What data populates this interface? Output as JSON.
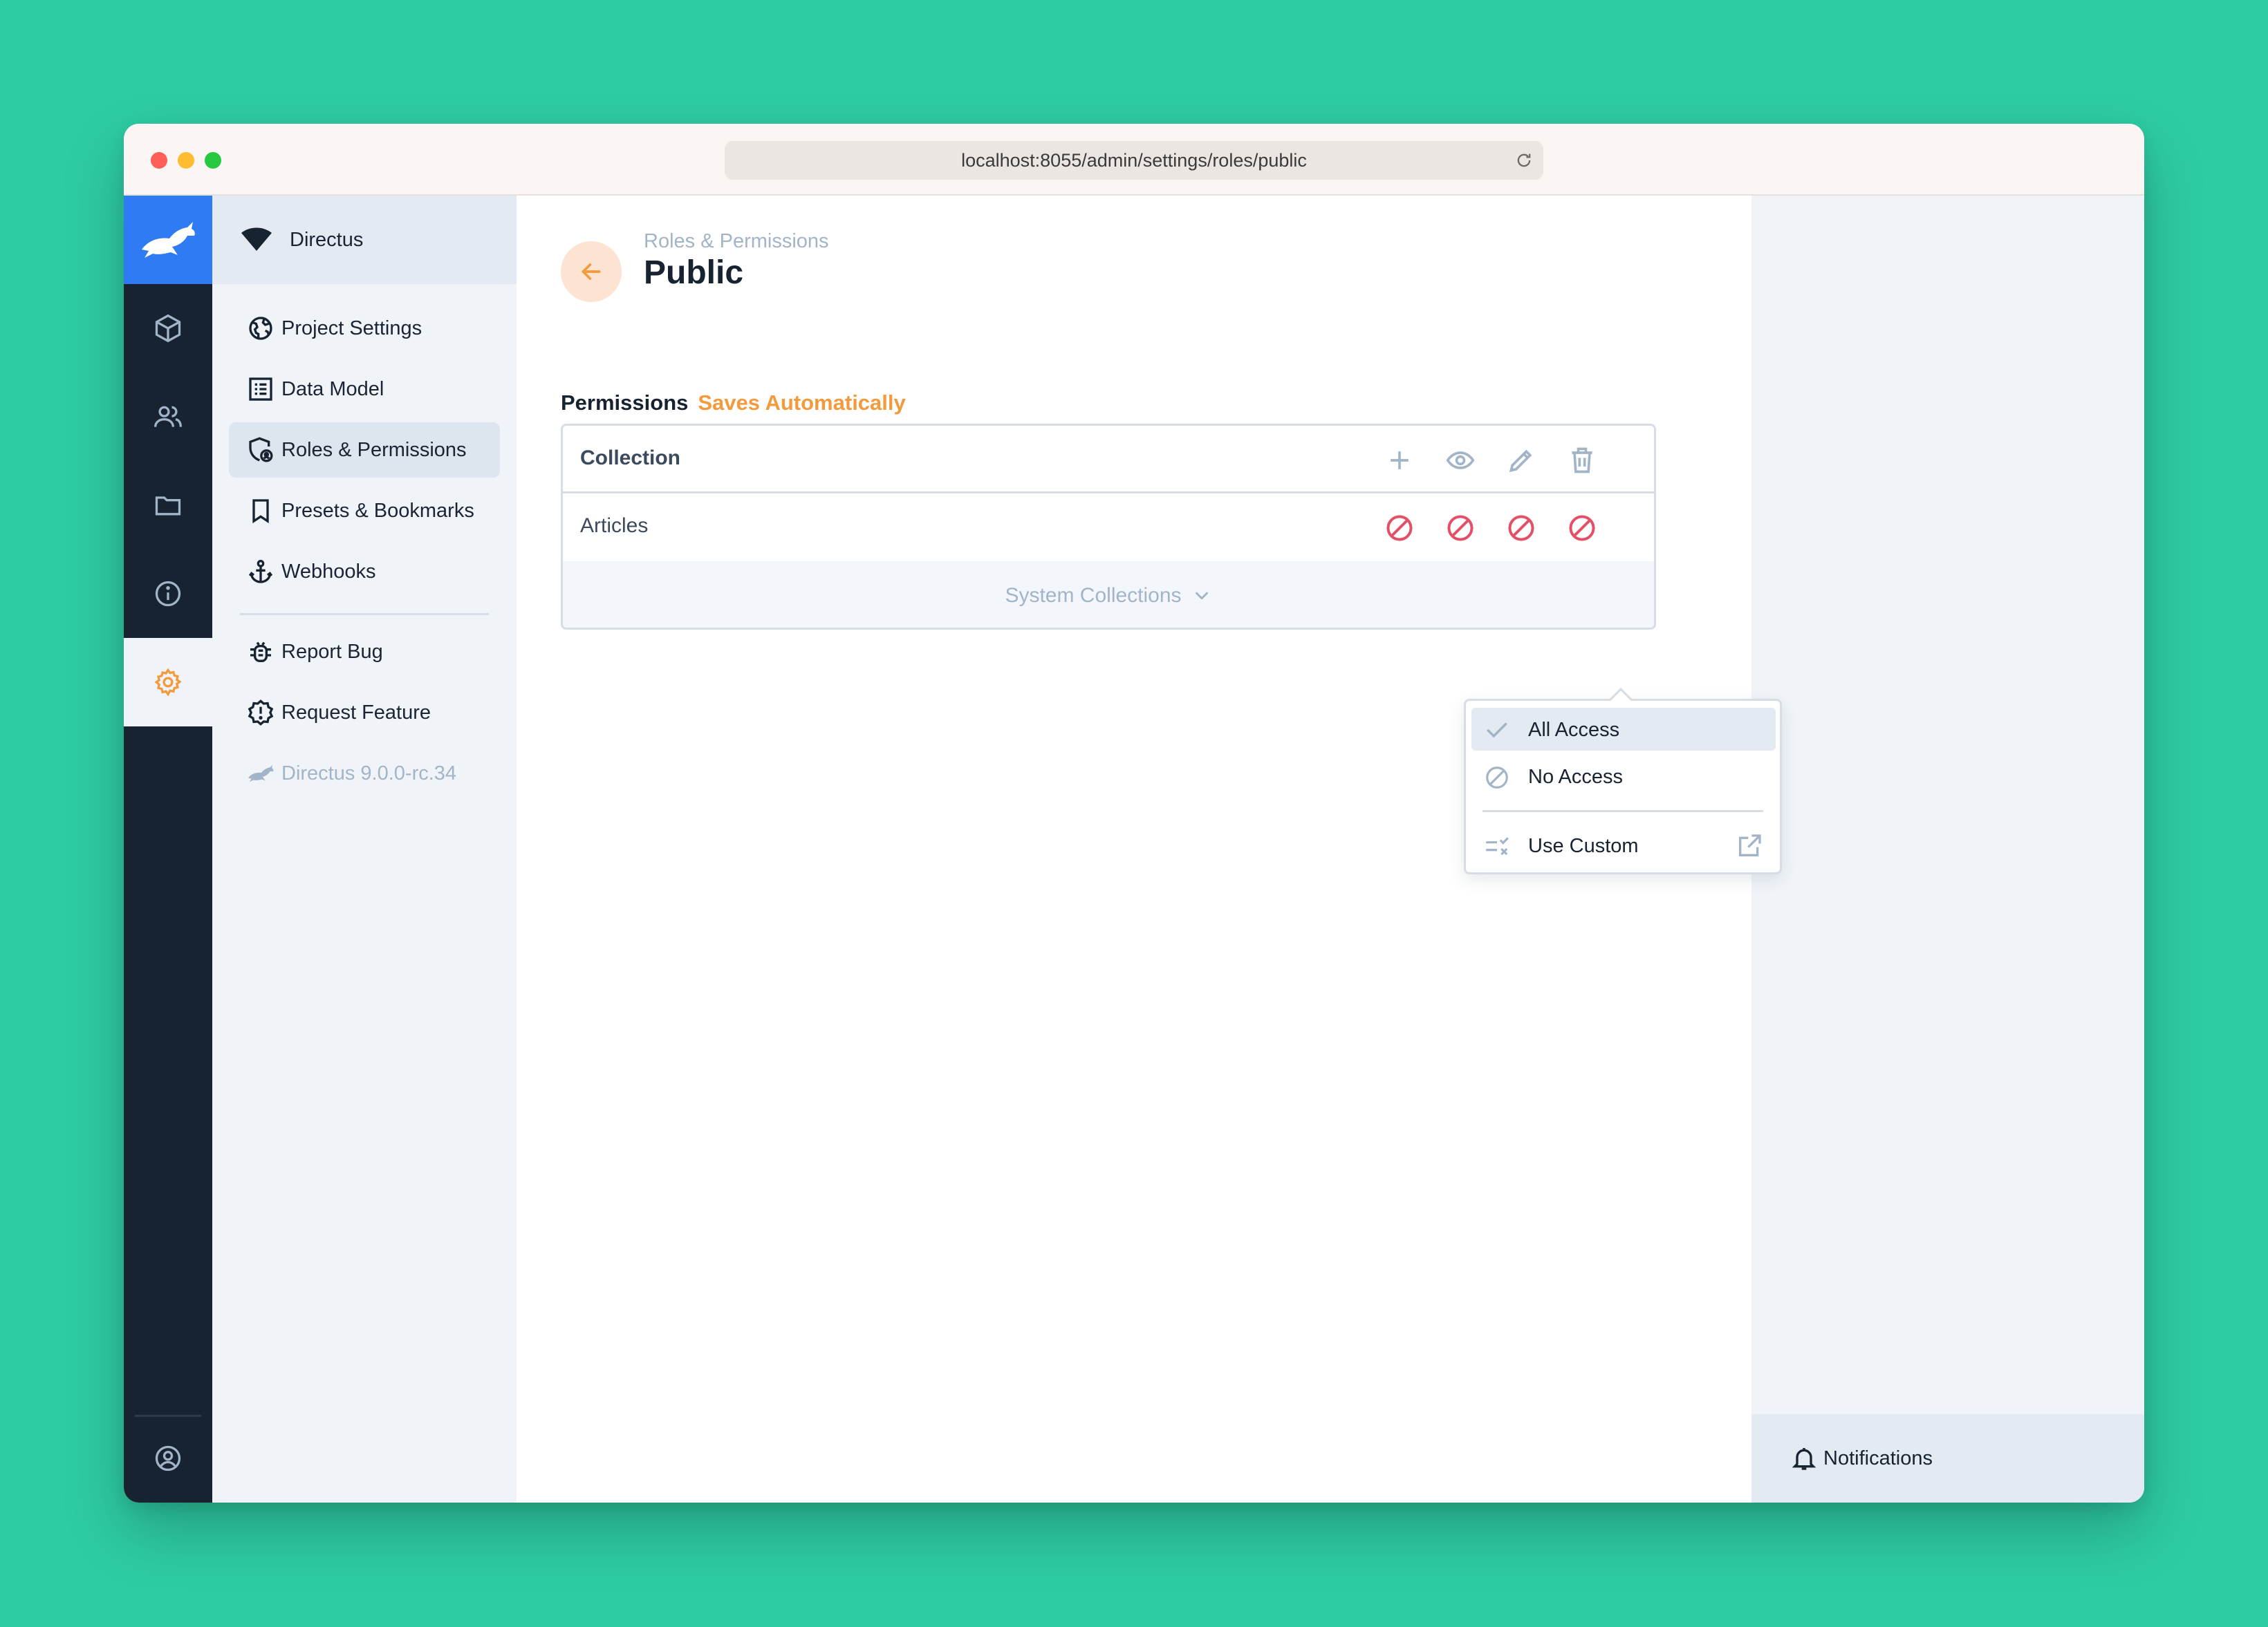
{
  "browser": {
    "url": "localhost:8055/admin/settings/roles/public"
  },
  "nav": {
    "project_name": "Directus",
    "items": [
      {
        "label": "Project Settings",
        "icon": "globe-icon"
      },
      {
        "label": "Data Model",
        "icon": "list-alt-icon"
      },
      {
        "label": "Roles & Permissions",
        "icon": "shield-user-icon",
        "active": true
      },
      {
        "label": "Presets & Bookmarks",
        "icon": "bookmark-icon"
      },
      {
        "label": "Webhooks",
        "icon": "anchor-icon"
      }
    ],
    "secondary": [
      {
        "label": "Report Bug",
        "icon": "bug-icon"
      },
      {
        "label": "Request Feature",
        "icon": "new-releases-icon"
      },
      {
        "label": "Directus 9.0.0-rc.34",
        "icon": "directus-rabbit-icon"
      }
    ]
  },
  "header": {
    "breadcrumb": "Roles & Permissions",
    "title": "Public"
  },
  "permissions": {
    "heading": "Permissions",
    "subheading": "Saves Automatically",
    "column_header": "Collection",
    "action_icons": [
      "add-icon",
      "eye-icon",
      "pencil-icon",
      "trash-icon"
    ],
    "rows": [
      {
        "collection": "Articles",
        "states": [
          "no-access",
          "no-access",
          "no-access",
          "no-access"
        ]
      }
    ],
    "system_collections_label": "System Collections"
  },
  "dropdown": {
    "items": [
      {
        "label": "All Access",
        "icon": "check-icon",
        "active": true
      },
      {
        "label": "No Access",
        "icon": "block-icon"
      },
      {
        "label": "Use Custom",
        "icon": "rule-icon",
        "trailing_icon": "launch-icon"
      }
    ]
  },
  "notifications": {
    "label": "Notifications"
  },
  "colors": {
    "background": "#2ecca3",
    "rail": "#172331",
    "logo": "#2f7bf4",
    "accent_orange": "#f39a3c",
    "danger": "#e35169",
    "muted": "#a2b4c7"
  }
}
